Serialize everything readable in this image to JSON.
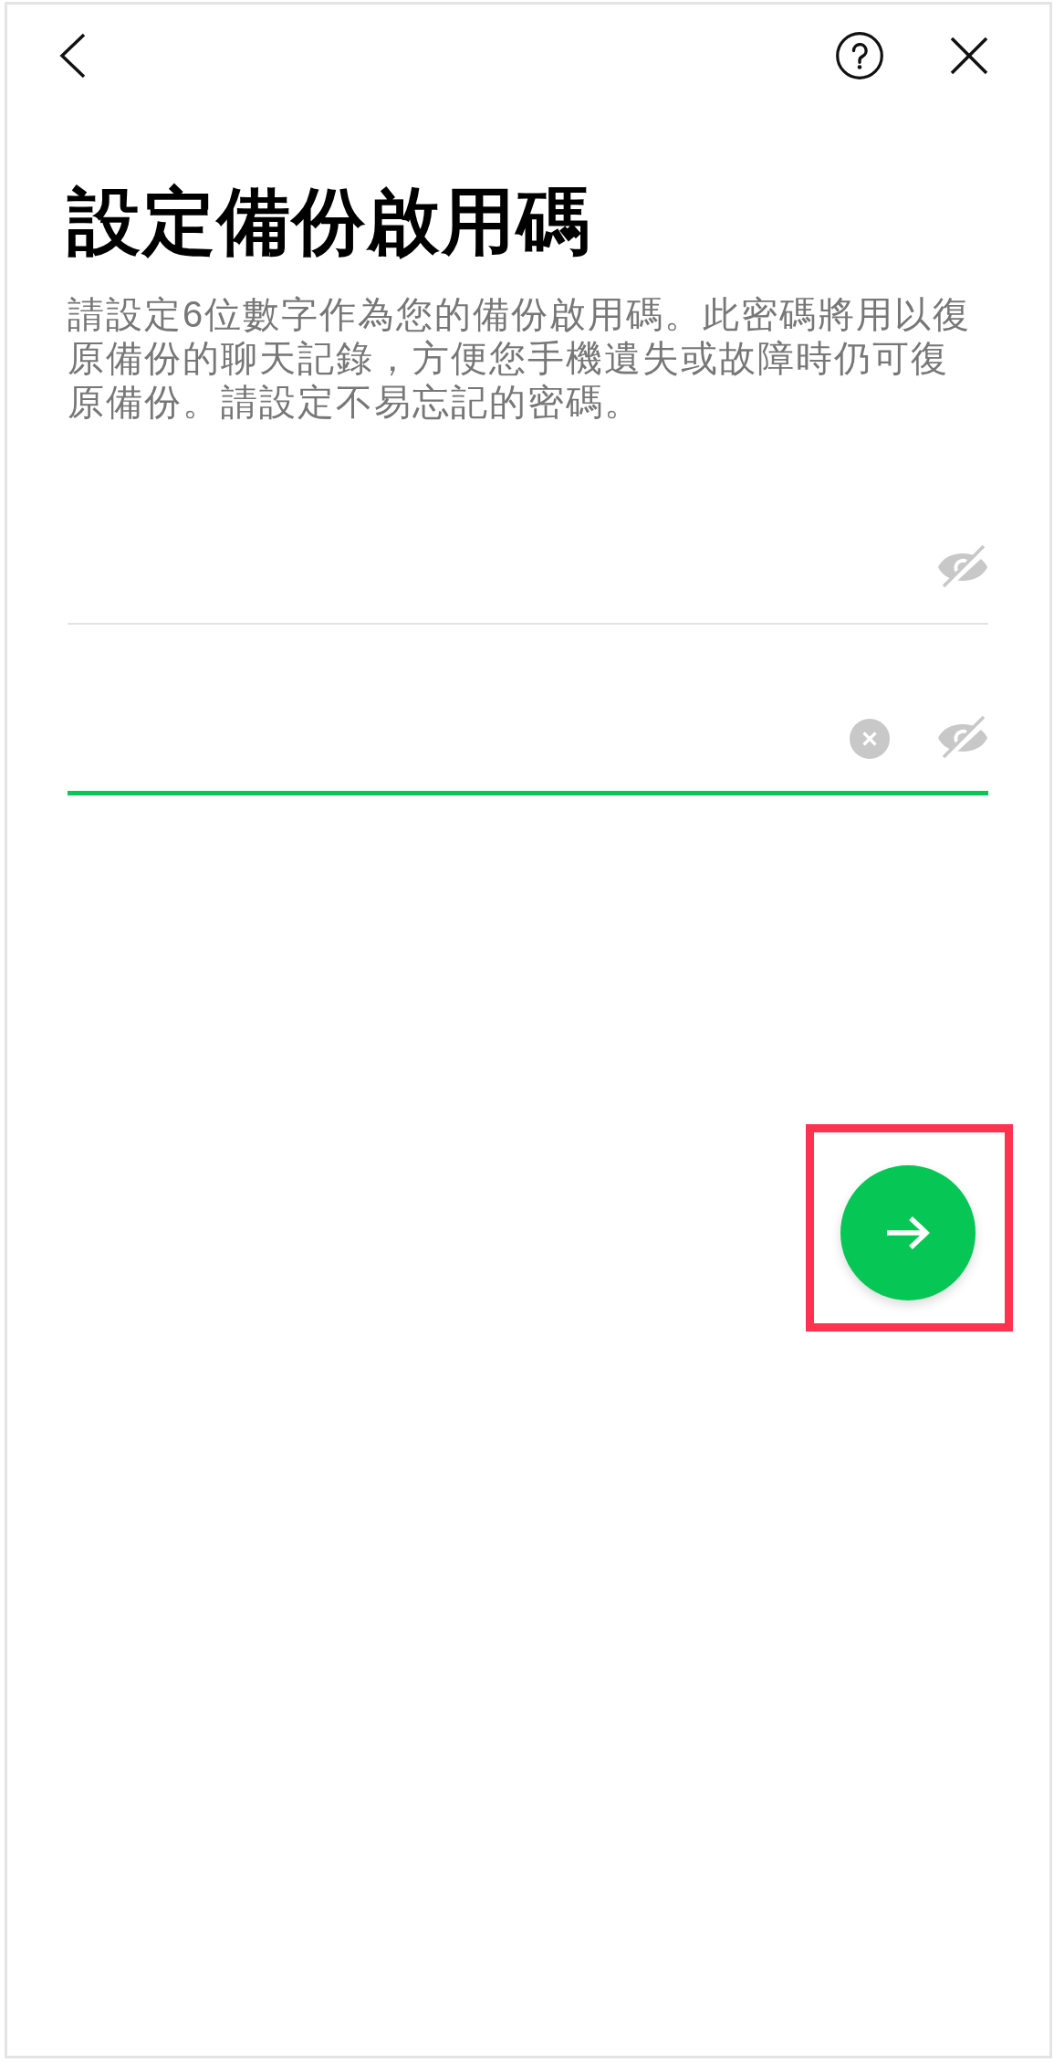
{
  "title": "設定備份啟用碼",
  "description": "請設定6位數字作為您的備份啟用碼。此密碼將用以復原備份的聊天記錄，方便您手機遺失或故障時仍可復原備份。請設定不易忘記的密碼。",
  "fields": [
    {
      "focused": false,
      "show_clear": false,
      "password_hidden": true
    },
    {
      "focused": true,
      "show_clear": true,
      "password_hidden": true
    }
  ],
  "next_button": {
    "highlighted": true
  }
}
